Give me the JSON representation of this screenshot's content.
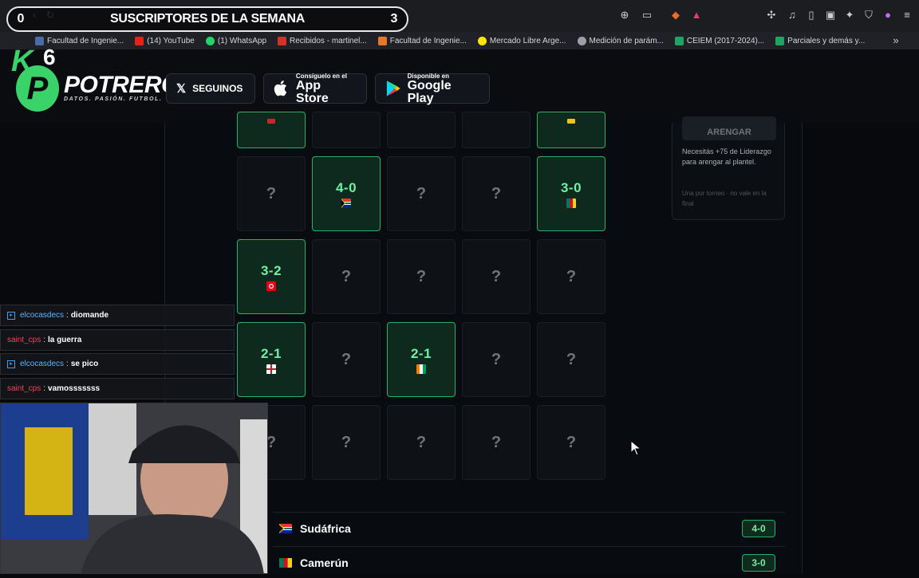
{
  "banner": {
    "title": "SUSCRIPTORES DE LA SEMANA",
    "left_count": "0",
    "right_count": "3"
  },
  "bookmarks": [
    {
      "label": "Facultad de Ingenie...",
      "color": "#4a6da7"
    },
    {
      "label": "(14) YouTube",
      "color": "#e62117"
    },
    {
      "label": "(1) WhatsApp",
      "color": "#25d366"
    },
    {
      "label": "Recibidos - martinel...",
      "color": "#d93025"
    },
    {
      "label": "Facultad de Ingenie...",
      "color": "#e8772e"
    },
    {
      "label": "Mercado Libre Arge...",
      "color": "#ffe600"
    },
    {
      "label": "Medición de parám...",
      "color": "#9aa0a6"
    },
    {
      "label": "CEIEM (2017-2024)...",
      "color": "#1fa463"
    },
    {
      "label": "Parciales y demás y...",
      "color": "#1fa463"
    }
  ],
  "overlay": {
    "k_letter": "K",
    "k_number": "6"
  },
  "brand": {
    "logo_letter": "P",
    "name": "POTRERO",
    "tagline": "DATOS. PASIÓN. FUTBOL."
  },
  "header": {
    "follow_label": "SEGUINOS",
    "appstore_small": "Consíguelo en el",
    "appstore_big": "App Store",
    "googleplay_small": "Disponible en",
    "googleplay_big": "Google Play"
  },
  "grid": {
    "unknown_symbol": "?",
    "row1": [
      {
        "state": "won-partial",
        "color": "#d4202c"
      },
      {
        "state": "empty"
      },
      {
        "state": "empty"
      },
      {
        "state": "empty"
      },
      {
        "state": "won-partial",
        "color": "#f2c500"
      }
    ],
    "row2": [
      {
        "state": "unknown"
      },
      {
        "state": "won",
        "score": "4-0",
        "flag": "sa"
      },
      {
        "state": "unknown"
      },
      {
        "state": "unknown"
      },
      {
        "state": "won",
        "score": "3-0",
        "flag": "cm"
      }
    ],
    "row3": [
      {
        "state": "won",
        "score": "3-2",
        "flag": "tn"
      },
      {
        "state": "unknown"
      },
      {
        "state": "unknown"
      },
      {
        "state": "unknown"
      },
      {
        "state": "unknown"
      }
    ],
    "row4": [
      {
        "state": "won",
        "score": "2-1",
        "flag": "en"
      },
      {
        "state": "unknown"
      },
      {
        "state": "won",
        "score": "2-1",
        "flag": "ci"
      },
      {
        "state": "unknown"
      },
      {
        "state": "unknown"
      }
    ],
    "row5": [
      {
        "state": "unknown"
      },
      {
        "state": "unknown"
      },
      {
        "state": "unknown"
      },
      {
        "state": "unknown"
      },
      {
        "state": "unknown"
      }
    ]
  },
  "side_panel": {
    "button_label": "ARENGAR",
    "note": "Necesitás +75 de Liderazgo para arengar al plantel.",
    "subnote": "Una por torneo · no vale en la final"
  },
  "results": [
    {
      "team": "Sudáfrica",
      "score": "4-0"
    },
    {
      "team": "Camerún",
      "score": "3-0"
    }
  ],
  "chat": [
    {
      "user": "elcocasdecs",
      "user_color": "#5ab4ff",
      "separator": ":",
      "message": "diomande",
      "badge": true
    },
    {
      "user": "saint_cps",
      "user_color": "#ff3b5c",
      "separator": ":",
      "message": "la guerra",
      "badge": false
    },
    {
      "user": "elcocasdecs",
      "user_color": "#5ab4ff",
      "separator": ":",
      "message": "se pico",
      "badge": true
    },
    {
      "user": "saint_cps",
      "user_color": "#ff3b5c",
      "separator": ":",
      "message": "vamosssssss",
      "badge": false
    }
  ],
  "colors": {
    "accent": "#39d36a",
    "won_bg": "#0e2a1f",
    "won_border": "#27b168",
    "score_text": "#6ff0a3"
  }
}
